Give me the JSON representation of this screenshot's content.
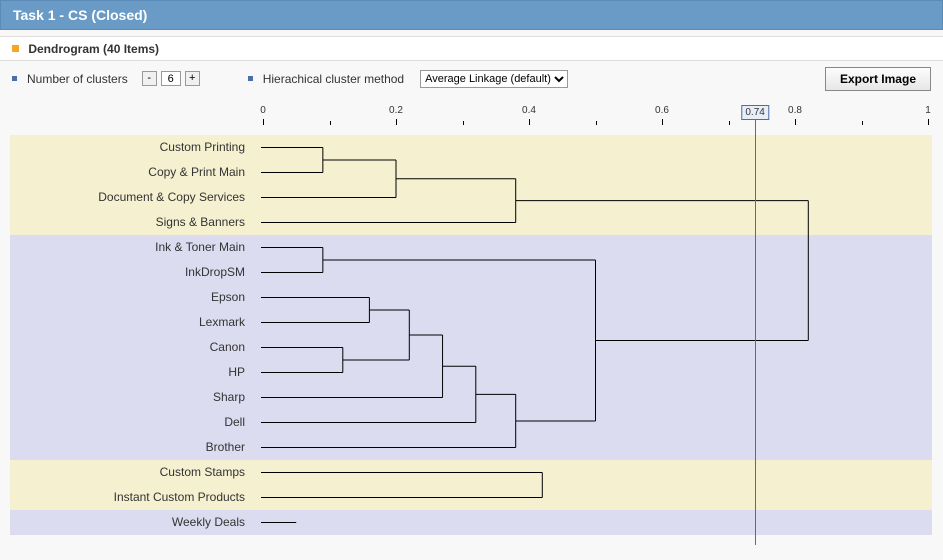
{
  "header": {
    "title": "Task 1 - CS (Closed)"
  },
  "subtitle": {
    "text": "Dendrogram (40 Items)"
  },
  "controls": {
    "clusters": {
      "label": "Number of clusters",
      "value": "6"
    },
    "method": {
      "label": "Hierachical cluster method",
      "selected": "Average Linkage (default)",
      "options": [
        "Average Linkage (default)"
      ]
    },
    "export": {
      "label": "Export Image"
    }
  },
  "axis": {
    "min": 0,
    "max": 1,
    "major": [
      "0",
      "0.2",
      "0.4",
      "0.6",
      "0.8",
      "1"
    ],
    "threshold": "0.74"
  },
  "items": [
    {
      "label": "Custom Printing",
      "band": "a"
    },
    {
      "label": "Copy & Print Main",
      "band": "a"
    },
    {
      "label": "Document & Copy Services",
      "band": "a"
    },
    {
      "label": "Signs & Banners",
      "band": "a"
    },
    {
      "label": "Ink & Toner Main",
      "band": "b"
    },
    {
      "label": "InkDropSM",
      "band": "b"
    },
    {
      "label": "Epson",
      "band": "b"
    },
    {
      "label": "Lexmark",
      "band": "b"
    },
    {
      "label": "Canon",
      "band": "b"
    },
    {
      "label": "HP",
      "band": "b"
    },
    {
      "label": "Sharp",
      "band": "b"
    },
    {
      "label": "Dell",
      "band": "b"
    },
    {
      "label": "Brother",
      "band": "b"
    },
    {
      "label": "Custom Stamps",
      "band": "a"
    },
    {
      "label": "Instant Custom Products",
      "band": "a"
    },
    {
      "label": "Weekly Deals",
      "band": "b"
    }
  ],
  "chart_data": {
    "type": "dendrogram",
    "xlabel": "",
    "ylabel": "",
    "xlim": [
      0,
      1
    ],
    "threshold": 0.74,
    "n_clusters": 6,
    "leaves": [
      "Custom Printing",
      "Copy & Print Main",
      "Document & Copy Services",
      "Signs & Banners",
      "Ink & Toner Main",
      "InkDropSM",
      "Epson",
      "Lexmark",
      "Canon",
      "HP",
      "Sharp",
      "Dell",
      "Brother",
      "Custom Stamps",
      "Instant Custom Products",
      "Weekly Deals"
    ],
    "merges": [
      {
        "id": "m1",
        "children": [
          "Custom Printing",
          "Copy & Print Main"
        ],
        "height": 0.09
      },
      {
        "id": "m2",
        "children": [
          "m1",
          "Document & Copy Services"
        ],
        "height": 0.2
      },
      {
        "id": "m3",
        "children": [
          "m2",
          "Signs & Banners"
        ],
        "height": 0.38
      },
      {
        "id": "m4",
        "children": [
          "Ink & Toner Main",
          "InkDropSM"
        ],
        "height": 0.09
      },
      {
        "id": "m5",
        "children": [
          "Epson",
          "Lexmark"
        ],
        "height": 0.16
      },
      {
        "id": "m6",
        "children": [
          "Canon",
          "HP"
        ],
        "height": 0.12
      },
      {
        "id": "m7",
        "children": [
          "m5",
          "m6"
        ],
        "height": 0.22
      },
      {
        "id": "m8",
        "children": [
          "m7",
          "Sharp"
        ],
        "height": 0.27
      },
      {
        "id": "m9",
        "children": [
          "m8",
          "Dell"
        ],
        "height": 0.32
      },
      {
        "id": "m10",
        "children": [
          "m9",
          "Brother"
        ],
        "height": 0.38
      },
      {
        "id": "m11",
        "children": [
          "m4",
          "m10"
        ],
        "height": 0.5
      },
      {
        "id": "m12",
        "children": [
          "m3",
          "m11"
        ],
        "height": 0.82
      },
      {
        "id": "m13",
        "children": [
          "Custom Stamps",
          "Instant Custom Products"
        ],
        "height": 0.42
      }
    ]
  }
}
